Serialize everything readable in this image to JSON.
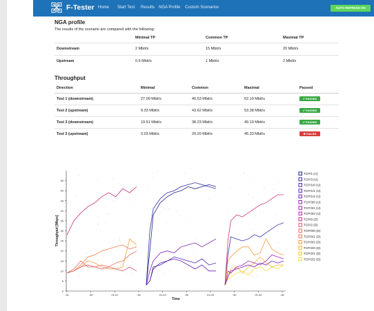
{
  "nav": {
    "brand": "F-Tester",
    "items": [
      "Home",
      "Start Test",
      "Results",
      "NGA Profile",
      "Custom Scenarios"
    ],
    "badge": "AUTO REFRESH ON"
  },
  "nga": {
    "title": "NGA profile",
    "description": "The results of the scenario are compared with the following:",
    "headers": [
      "",
      "Minimal TP",
      "Common TP",
      "Maximal TP"
    ],
    "rows": [
      {
        "name": "Downstream",
        "min": "2 Mbit/s",
        "common": "15 Mbit/s",
        "max": "20 Mbit/s"
      },
      {
        "name": "Upstream",
        "min": "0.5 Mbit/s",
        "common": "1 Mbit/s",
        "max": "2 Mbit/s"
      }
    ]
  },
  "throughput": {
    "title": "Throughput",
    "headers": [
      "Direction",
      "Minimal",
      "Common",
      "Maximal",
      "Passed"
    ],
    "rows": [
      {
        "name": "Test 1 (downstream)",
        "min": "27.09 Mbit/s",
        "common": "40.53 Mbit/s",
        "max": "52.19 Mbit/s",
        "status": "✔ PASSED",
        "pass": true
      },
      {
        "name": "Test 2 (upstream)",
        "min": "9.33 Mbit/s",
        "common": "43.62 Mbit/s",
        "max": "53.38 Mbit/s",
        "status": "✔ PASSED",
        "pass": true
      },
      {
        "name": "Test 3 (downstream)",
        "min": "19.51 Mbit/s",
        "common": "38.23 Mbit/s",
        "max": "49.19 Mbit/s",
        "status": "✔ PASSED",
        "pass": true
      },
      {
        "name": "Test 3 (upstream)",
        "min": "0.03 Mbit/s",
        "common": "29.20 Mbit/s",
        "max": "45.33 Mbit/s",
        "status": "✖ FAILED",
        "pass": false
      }
    ]
  },
  "chart_data": {
    "type": "line",
    "xlabel": "Time",
    "ylabel": "Throughput [Mbps]",
    "ylim": [
      0,
      60
    ],
    "yticks": [
      0,
      5,
      10,
      15,
      20,
      25,
      30,
      35,
      40,
      45,
      50,
      55
    ],
    "xticks": [
      ":31",
      ":30",
      "01:01",
      ":30",
      "01:02",
      ":30",
      "01:03",
      ":30",
      "01:04",
      ":30"
    ],
    "grid": false,
    "legend_position": "right",
    "series": [
      {
        "name": "TCP/1 (U)",
        "color": "#1f1f8f"
      },
      {
        "name": "TCP/3 (U)",
        "color": "#2e2ea8"
      },
      {
        "name": "TCP/1/0 (U)",
        "color": "#4b22a8"
      },
      {
        "name": "TCP/1/1 (U)",
        "color": "#5e1fb0"
      },
      {
        "name": "TCP/1/2 (U)",
        "color": "#7a1fb3"
      },
      {
        "name": "TCP/3/0 (U)",
        "color": "#8f20b5"
      },
      {
        "name": "TCP/3/1 (U)",
        "color": "#a524b0"
      },
      {
        "name": "TCP/3/2 (U)",
        "color": "#b92aa8"
      },
      {
        "name": "TCP/0 (D)",
        "color": "#c93480"
      },
      {
        "name": "TCP/2 (D)",
        "color": "#d9566d"
      },
      {
        "name": "TCP/0/0 (D)",
        "color": "#e86a5c"
      },
      {
        "name": "TCP/0/1 (D)",
        "color": "#f07a4a"
      },
      {
        "name": "TCP/0/2 (D)",
        "color": "#f59a3a"
      },
      {
        "name": "TCP/2/0 (D)",
        "color": "#f7b52e"
      },
      {
        "name": "TCP/2/1 (D)",
        "color": "#f7c92c"
      },
      {
        "name": "TCP/2/2 (D)",
        "color": "#f2dc3a"
      }
    ],
    "segments": [
      {
        "x": [
          0.0,
          0.1,
          0.2,
          0.3,
          0.4,
          0.5,
          0.6,
          0.7,
          0.8,
          0.9,
          1.0
        ],
        "lines": [
          {
            "color": "#c93480",
            "y": [
              28,
              35,
              39,
              42,
              44,
              47,
              49,
              47,
              51,
              49,
              52
            ]
          },
          {
            "color": "#f07a4a",
            "y": [
              9,
              10,
              13,
              17,
              18,
              20,
              21,
              22,
              23,
              21,
              22
            ]
          },
          {
            "color": "#e86a5c",
            "y": [
              9,
              11,
              15,
              12,
              12,
              13,
              12,
              14,
              15,
              18,
              20
            ]
          },
          {
            "color": "#f59a3a",
            "y": [
              9,
              10,
              12,
              15,
              14,
              12,
              11,
              11,
              12,
              26,
              23
            ]
          },
          {
            "color": "#d9566d",
            "y": [
              9,
              10,
              12,
              13,
              12,
              11,
              12,
              11,
              10,
              12,
              10
            ]
          }
        ]
      },
      {
        "x": [
          0.0,
          0.05,
          0.1,
          0.2,
          0.3,
          0.4,
          0.5,
          0.6,
          0.7,
          0.8,
          0.9,
          1.0
        ],
        "lines": [
          {
            "color": "#2e2ea8",
            "y": [
              3,
              30,
              41,
              46,
              49,
              50,
              52,
              53,
              54,
              53,
              52,
              51
            ]
          },
          {
            "color": "#1f1f8f",
            "y": [
              3,
              20,
              38,
              44,
              47,
              49,
              50,
              52,
              51,
              52,
              53,
              52
            ]
          },
          {
            "color": "#7a1fb3",
            "y": [
              3,
              10,
              15,
              19,
              20,
              19,
              22,
              23,
              24,
              22,
              24,
              26
            ]
          },
          {
            "color": "#5e1fb0",
            "y": [
              3,
              5,
              11,
              14,
              15,
              16,
              15,
              13,
              11,
              13,
              10,
              10
            ]
          },
          {
            "color": "#4b22a8",
            "y": [
              3,
              5,
              12,
              13,
              15,
              17,
              16,
              15,
              14,
              16,
              13,
              14
            ]
          }
        ]
      },
      {
        "x": [
          0.0,
          0.05,
          0.1,
          0.2,
          0.3,
          0.4,
          0.5,
          0.6,
          0.7,
          0.8,
          0.9,
          1.0
        ],
        "lines": [
          {
            "color": "#c93480",
            "y": [
              3,
              25,
              35,
              38,
              37,
              39,
              41,
              43,
              44,
              46,
              48,
              48
            ]
          },
          {
            "color": "#2e2ea8",
            "y": [
              3,
              18,
              27,
              26,
              25,
              26,
              28,
              27,
              29,
              31,
              33,
              34
            ]
          },
          {
            "color": "#f59a3a",
            "y": [
              3,
              15,
              17,
              20,
              22,
              22,
              18,
              19,
              26,
              21,
              19,
              18
            ]
          },
          {
            "color": "#f7b52e",
            "y": [
              3,
              8,
              11,
              12,
              9,
              12,
              14,
              17,
              14,
              12,
              13,
              13
            ]
          },
          {
            "color": "#a524b0",
            "y": [
              3,
              10,
              9,
              12,
              13,
              15,
              14,
              13,
              15,
              18,
              17,
              16
            ]
          },
          {
            "color": "#f2dc3a",
            "y": [
              3,
              6,
              7,
              9,
              10,
              8,
              11,
              12,
              10,
              12,
              11,
              13
            ]
          },
          {
            "color": "#7a1fb3",
            "y": [
              3,
              7,
              10,
              11,
              12,
              13,
              12,
              14,
              13,
              15,
              14,
              15
            ]
          }
        ]
      }
    ]
  }
}
